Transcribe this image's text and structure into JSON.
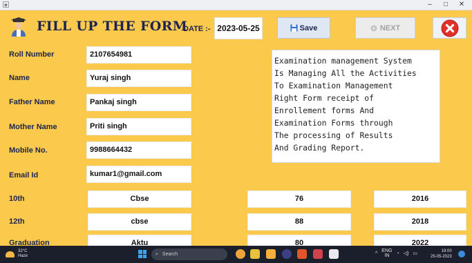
{
  "window": {
    "min_label": "–",
    "max_label": "□",
    "close_label": "✕"
  },
  "header": {
    "title": "FILL UP THE FORM",
    "date_label": "DATE :-",
    "date_value": "2023-05-25",
    "save_label": "Save",
    "next_label": "NEXT"
  },
  "form": {
    "roll_number": {
      "label": "Roll Number",
      "value": "2107654981"
    },
    "name": {
      "label": "Name",
      "value": "Yuraj singh"
    },
    "father_name": {
      "label": "Father Name",
      "value": "Pankaj singh"
    },
    "mother_name": {
      "label": "Mother Name",
      "value": "Priti singh"
    },
    "mobile": {
      "label": "Mobile No.",
      "value": "9988664432"
    },
    "email": {
      "label": "Email Id",
      "value": "kumar1@gmail.com"
    }
  },
  "about_text": "Examination management System\nIs Managing All the Activities\nTo Examination Management\nRight Form receipt of\nEnrollement forms And\nExamination Forms through\nThe processing of Results\nAnd Grading Report.",
  "education": [
    {
      "label": "10th",
      "board": "Cbse",
      "marks": "76",
      "year": "2016"
    },
    {
      "label": "12th",
      "board": "cbse",
      "marks": "88",
      "year": "2018"
    },
    {
      "label": "Graduation",
      "board": "Aktu",
      "marks": "80",
      "year": "2022"
    }
  ],
  "taskbar": {
    "temperature": "32°C",
    "weather": "Haze",
    "search_placeholder": "Search",
    "lang": "ENG",
    "region": "IN",
    "time": "19:00",
    "date": "25-05-2023"
  },
  "colors": {
    "background": "#fbc94c",
    "label_text": "#1d2450",
    "close_red": "#e0302a",
    "save_blue": "#2b6cd4"
  }
}
